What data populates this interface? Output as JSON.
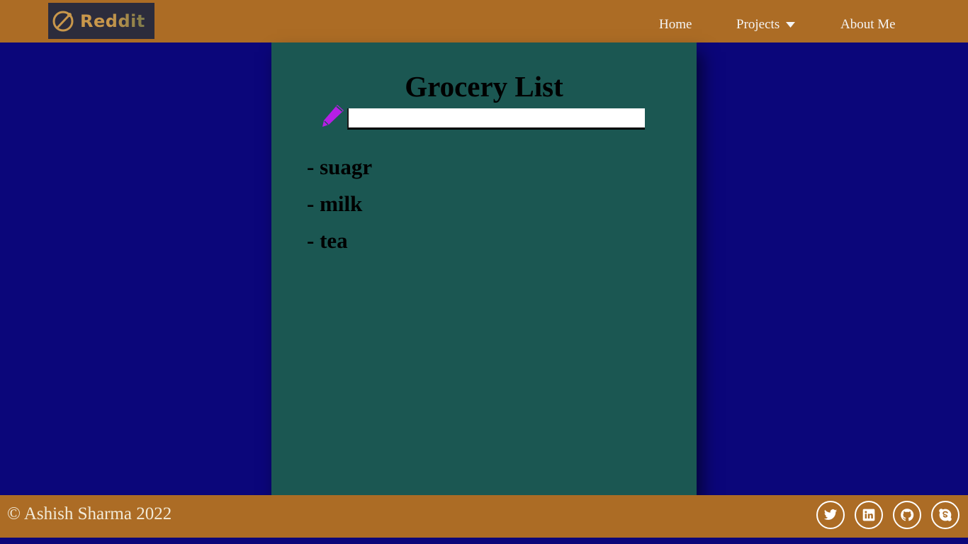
{
  "nav": {
    "logo_text": "Reddit",
    "links": [
      {
        "label": "Home"
      },
      {
        "label": "Projects"
      },
      {
        "label": "About Me"
      }
    ]
  },
  "card": {
    "title": "Grocery List",
    "input": {
      "value": "",
      "placeholder": ""
    },
    "items": [
      {
        "text": "- suagr"
      },
      {
        "text": "- milk"
      },
      {
        "text": "- tea"
      }
    ]
  },
  "footer": {
    "copyright": "© Ashish Sharma 2022",
    "social": [
      {
        "icon": "twitter-icon"
      },
      {
        "icon": "linkedin-icon"
      },
      {
        "icon": "github-icon"
      },
      {
        "icon": "skype-icon"
      }
    ]
  },
  "colors": {
    "page_background": "#0b067a",
    "bar": "#ac6c25",
    "card": "#1b5752",
    "pencil": "#b71ee6"
  }
}
